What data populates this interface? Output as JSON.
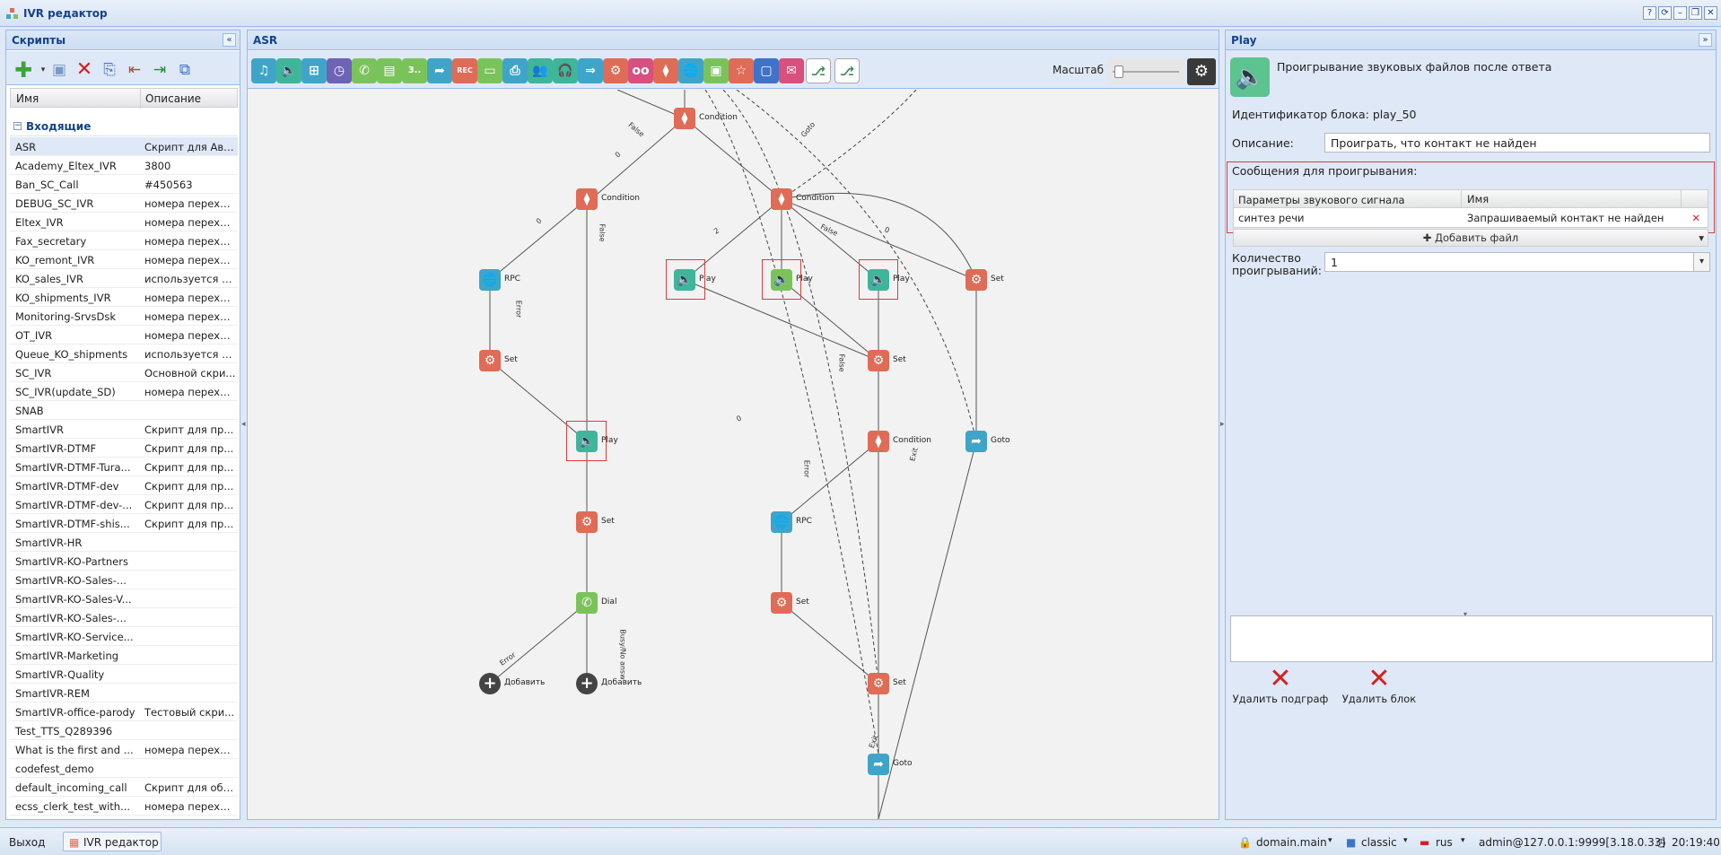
{
  "window": {
    "title": "IVR редактор",
    "buttons": [
      "?",
      "⟳",
      "–",
      "❐",
      "✕"
    ]
  },
  "scripts_panel": {
    "title": "Скрипты",
    "columns": {
      "name": "Имя",
      "description": "Описание"
    },
    "group": "Входящие",
    "rows": [
      {
        "name": "ASR",
        "desc": "Скрипт для Авт..."
      },
      {
        "name": "Academy_Eltex_IVR",
        "desc": "3800"
      },
      {
        "name": "Ban_SC_Call",
        "desc": "#450563"
      },
      {
        "name": "DEBUG_SC_IVR",
        "desc": "номера перехо..."
      },
      {
        "name": "Eltex_IVR",
        "desc": "номера перехо..."
      },
      {
        "name": "Fax_secretary",
        "desc": "номера перехо..."
      },
      {
        "name": "KO_remont_IVR",
        "desc": "номера перехо..."
      },
      {
        "name": "KO_sales_IVR",
        "desc": "используется п..."
      },
      {
        "name": "KO_shipments_IVR",
        "desc": "номера перехо..."
      },
      {
        "name": "Monitoring-SrvsDsk",
        "desc": "номера перехо..."
      },
      {
        "name": "OT_IVR",
        "desc": "номера перехо..."
      },
      {
        "name": "Queue_KO_shipments",
        "desc": "используется п..."
      },
      {
        "name": "SC_IVR",
        "desc": "Основной скри..."
      },
      {
        "name": "SC_IVR(update_SD)",
        "desc": "номера перехо..."
      },
      {
        "name": "SNAB",
        "desc": ""
      },
      {
        "name": "SmartIVR",
        "desc": "Скрипт для пр..."
      },
      {
        "name": "SmartIVR-DTMF",
        "desc": "Скрипт для пр..."
      },
      {
        "name": "SmartIVR-DTMF-Tura...",
        "desc": "Скрипт для пр..."
      },
      {
        "name": "SmartIVR-DTMF-dev",
        "desc": "Скрипт для пр..."
      },
      {
        "name": "SmartIVR-DTMF-dev-...",
        "desc": "Скрипт для пр..."
      },
      {
        "name": "SmartIVR-DTMF-shis...",
        "desc": "Скрипт для пр..."
      },
      {
        "name": "SmartIVR-HR",
        "desc": ""
      },
      {
        "name": "SmartIVR-KO-Partners",
        "desc": ""
      },
      {
        "name": "SmartIVR-KO-Sales-...",
        "desc": ""
      },
      {
        "name": "SmartIVR-KO-Sales-V...",
        "desc": ""
      },
      {
        "name": "SmartIVR-KO-Sales-...",
        "desc": ""
      },
      {
        "name": "SmartIVR-KO-Service...",
        "desc": ""
      },
      {
        "name": "SmartIVR-Marketing",
        "desc": ""
      },
      {
        "name": "SmartIVR-Quality",
        "desc": ""
      },
      {
        "name": "SmartIVR-REM",
        "desc": ""
      },
      {
        "name": "SmartIVR-office-parody",
        "desc": "Тестовый скри..."
      },
      {
        "name": "Test_TTS_Q289396",
        "desc": ""
      },
      {
        "name": "What is the first and ...",
        "desc": "номера перехо..."
      },
      {
        "name": "codefest_demo",
        "desc": ""
      },
      {
        "name": "default_incoming_call",
        "desc": "Скрипт для обр..."
      },
      {
        "name": "ecss_clerk_test_with...",
        "desc": "номера перехо..."
      }
    ]
  },
  "canvas_panel": {
    "title": "ASR",
    "scale_label": "Масштаб",
    "toolbar_colors": [
      "#3fa5c8",
      "#3fb59a",
      "#3fa5c8",
      "#6e63b5",
      "#7ac35a",
      "#7ac35a",
      "#7ac35a",
      "#3fa5c8",
      "#e06b56",
      "#7ac35a",
      "#3fa5c8",
      "#3fb59a",
      "#3fb59a",
      "#3fa5c8",
      "#e06b56",
      "#d94f7d",
      "#e06b56",
      "#3fa5c8",
      "#7ac35a",
      "#e06b56",
      "#3f73c8",
      "#d94f7d"
    ],
    "toolbar_glyphs": [
      "♫",
      "🔈",
      "⊞",
      "◷",
      "✆",
      "▤",
      "3..",
      "➦",
      "REC",
      "▭",
      "⎙",
      "👥",
      "🎧",
      "⇒",
      "⚙",
      "oo",
      "⧫",
      "🌐",
      "▣",
      "☆",
      "▢",
      "✉"
    ],
    "nodes": [
      {
        "id": "n1",
        "label": "Condition",
        "color": "#e06b56",
        "glyph": "⧫"
      },
      {
        "id": "n2",
        "label": "Condition",
        "color": "#e06b56",
        "glyph": "⧫"
      },
      {
        "id": "n3",
        "label": "Condition",
        "color": "#e06b56",
        "glyph": "⧫"
      },
      {
        "id": "n4",
        "label": "RPC",
        "color": "#3fa5c8",
        "glyph": "🌐"
      },
      {
        "id": "n5",
        "label": "Play",
        "color": "#3fb59a",
        "glyph": "🔈"
      },
      {
        "id": "n6",
        "label": "Play",
        "color": "#7ac35a",
        "glyph": "🔈"
      },
      {
        "id": "n7",
        "label": "Play",
        "color": "#3fb59a",
        "glyph": "🔈"
      },
      {
        "id": "n8",
        "label": "Set",
        "color": "#e06b56",
        "glyph": "⚙"
      },
      {
        "id": "n9",
        "label": "Set",
        "color": "#e06b56",
        "glyph": "⚙"
      },
      {
        "id": "n10",
        "label": "Set",
        "color": "#e06b56",
        "glyph": "⚙"
      },
      {
        "id": "n11",
        "label": "Play",
        "color": "#3fb59a",
        "glyph": "🔈"
      },
      {
        "id": "n12",
        "label": "Condition",
        "color": "#e06b56",
        "glyph": "⧫"
      },
      {
        "id": "n13",
        "label": "Goto",
        "color": "#3fa5c8",
        "glyph": "➦"
      },
      {
        "id": "n14",
        "label": "Set",
        "color": "#e06b56",
        "glyph": "⚙"
      },
      {
        "id": "n15",
        "label": "RPC",
        "color": "#3fa5c8",
        "glyph": "🌐"
      },
      {
        "id": "n16",
        "label": "Dial",
        "color": "#7ac35a",
        "glyph": "✆"
      },
      {
        "id": "n17",
        "label": "Set",
        "color": "#e06b56",
        "glyph": "⚙"
      },
      {
        "id": "n18",
        "label": "Добавить",
        "color": "#444444",
        "glyph": "+"
      },
      {
        "id": "n19",
        "label": "Добавить",
        "color": "#444444",
        "glyph": "+"
      },
      {
        "id": "n20",
        "label": "Set",
        "color": "#e06b56",
        "glyph": "⚙"
      },
      {
        "id": "n21",
        "label": "Goto",
        "color": "#3fa5c8",
        "glyph": "➦"
      }
    ],
    "edge_labels": [
      "False",
      "0",
      "Goto",
      "0",
      "False",
      "2",
      "False",
      "0",
      "Error",
      "Error",
      "False",
      "0",
      "Error",
      "Busy/No answ",
      "Exit",
      "Exit"
    ]
  },
  "play_panel": {
    "title": "Play",
    "heading": "Проигрывание звуковых файлов после ответа",
    "block_id_label": "Идентификатор блока: play_50",
    "description_label": "Описание:",
    "description_value": "Проиграть, что контакт не найден",
    "messages_label": "Сообщения для проигрывания:",
    "grid_columns": {
      "params": "Параметры звукового сигнала",
      "name": "Имя"
    },
    "grid_rows": [
      {
        "params": "синтез речи",
        "name": "Запрашиваемый контакт не найден"
      }
    ],
    "add_file": "Добавить файл",
    "count_label": "Количество проигрываний:",
    "count_value": "1",
    "delete_subgraph": "Удалить подграф",
    "delete_block": "Удалить блок"
  },
  "statusbar": {
    "exit": "Выход",
    "task": "IVR редактор",
    "domain": "domain.main",
    "theme": "classic",
    "lang": "rus",
    "user": "admin@127.0.0.1:9999[3.18.0.33]",
    "time": "20:19:40"
  }
}
